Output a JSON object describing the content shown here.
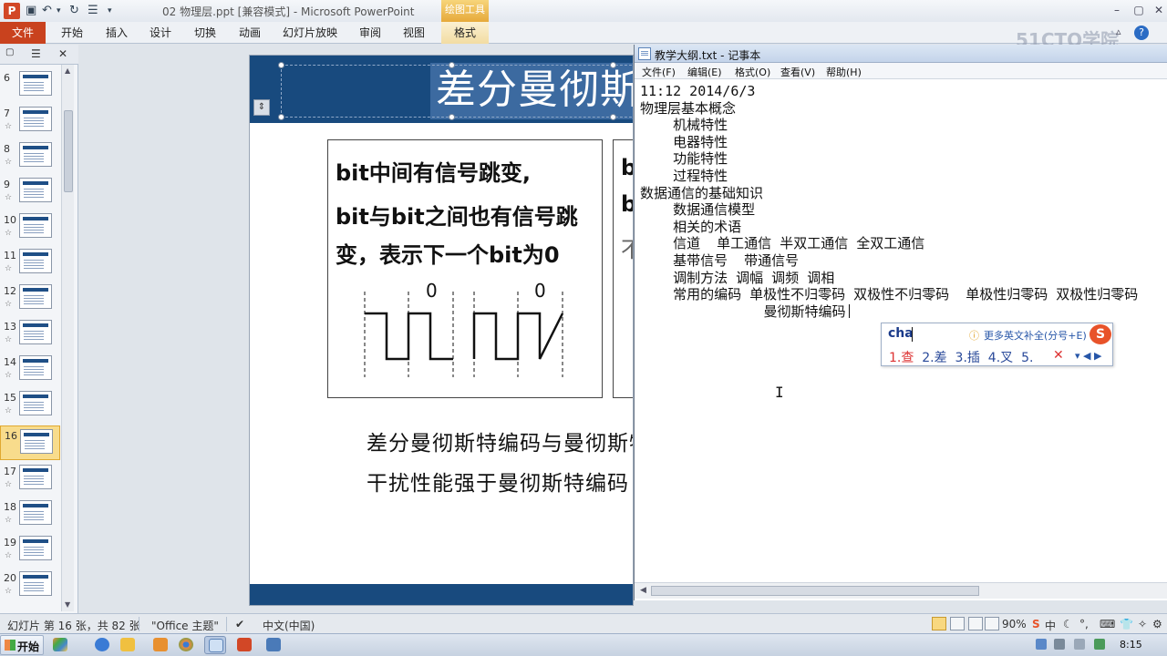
{
  "ppt": {
    "titlebar": {
      "app_logo": "P",
      "title": "02 物理层.ppt [兼容模式] - Microsoft PowerPoint",
      "contextual_tab": "绘图工具",
      "qat_icons": [
        "save-icon",
        "undo-icon",
        "redo-icon",
        "customize-icon"
      ]
    },
    "ribbon": {
      "file_tab": "文件",
      "tabs": [
        "开始",
        "插入",
        "设计",
        "切换",
        "动画",
        "幻灯片放映",
        "审阅",
        "视图",
        "格式"
      ],
      "watermark": "51CTO学院"
    },
    "thumbnails": [
      {
        "num": "6"
      },
      {
        "num": "7"
      },
      {
        "num": "8"
      },
      {
        "num": "9"
      },
      {
        "num": "10"
      },
      {
        "num": "11"
      },
      {
        "num": "12"
      },
      {
        "num": "13"
      },
      {
        "num": "14"
      },
      {
        "num": "15"
      },
      {
        "num": "16"
      },
      {
        "num": "17"
      },
      {
        "num": "18"
      },
      {
        "num": "19"
      },
      {
        "num": "20"
      }
    ],
    "active_slide": "16",
    "slide": {
      "title": "差分曼彻斯特编码",
      "card1_lines": [
        "bit中间有信号跳变,",
        "bit与bit之间也有信号跳",
        "变，表示下一个bit为0"
      ],
      "card2_lines": [
        "b",
        "b",
        "不"
      ],
      "waveform_labels": [
        "0",
        "0"
      ],
      "desc_lines": [
        "差分曼彻斯特编码与曼彻斯特编码相比，抗",
        "干扰性能强于曼彻斯特编码"
      ]
    },
    "status": {
      "slide_info": "幻灯片 第 16 张，共 82 张",
      "theme": "\"Office 主题\"",
      "language": "中文(中国)",
      "zoom": "90%"
    }
  },
  "notepad": {
    "title": "教学大纲.txt - 记事本",
    "menu": [
      "文件(F)",
      "编辑(E)",
      "格式(O)",
      "查看(V)",
      "帮助(H)"
    ],
    "lines": [
      "11:12 2014/6/3",
      "物理层基本概念",
      "    机械特性",
      "    电器特性",
      "    功能特性",
      "    过程特性",
      "数据通信的基础知识",
      "    数据通信模型",
      "    相关的术语",
      "    信道  单工通信 半双工通信 全双工通信",
      "    基带信号  带通信号",
      "    调制方法 调幅 调频 调相",
      "    常用的编码 单极性不归零码 双极性不归零码  单极性归零码 双极性归零码",
      "               曼彻斯特编码"
    ]
  },
  "ime": {
    "input": "cha",
    "hint": "更多英文补全(分号+E)",
    "candidates": [
      "1.查",
      "2.差",
      "3.插",
      "4.叉",
      "5."
    ]
  },
  "taskbar": {
    "start_label": "开始",
    "clock": "8:15"
  }
}
